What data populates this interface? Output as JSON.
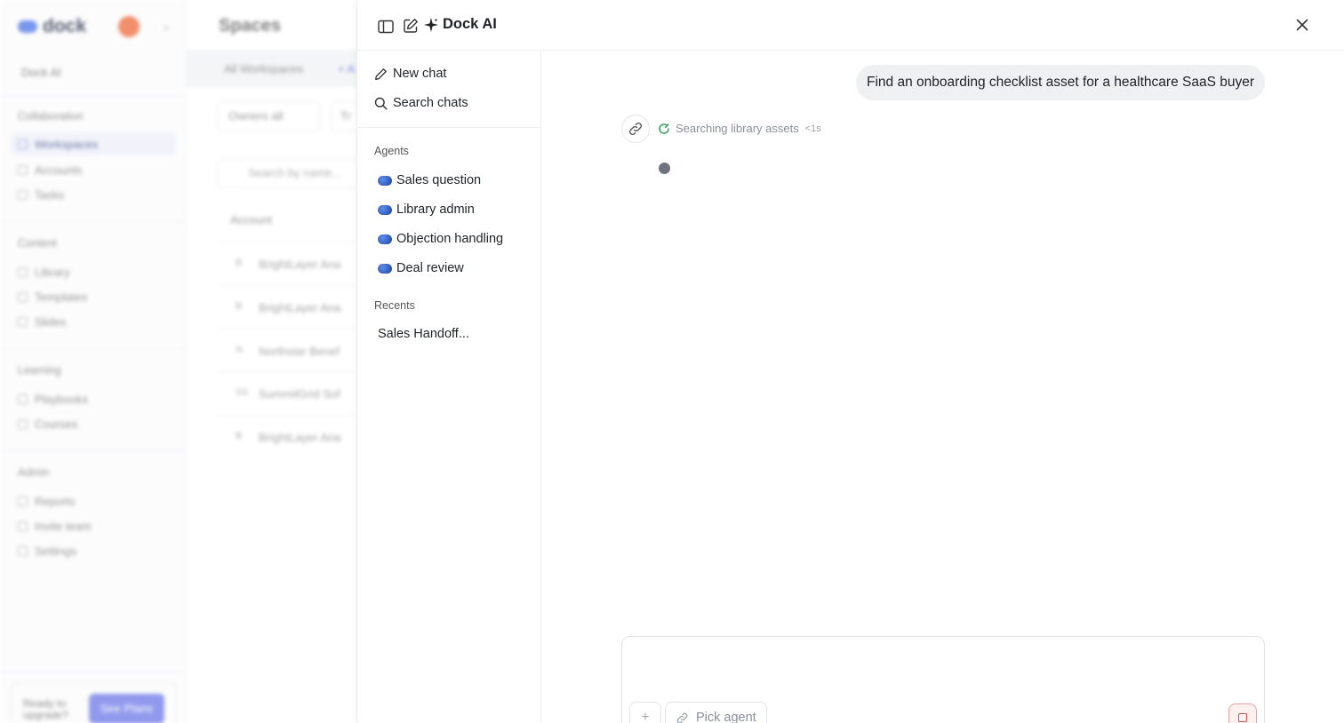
{
  "background": {
    "logo": "dock",
    "dock_ai": "Dock AI",
    "sections": {
      "collaboration": "Collaboration",
      "content": "Content",
      "learning": "Learning",
      "admin": "Admin"
    },
    "nav": {
      "workspaces": "Workspaces",
      "accounts": "Accounts",
      "tasks": "Tasks",
      "library": "Library",
      "templates": "Templates",
      "slides": "Slides",
      "playbooks": "Playbooks",
      "courses": "Courses",
      "reports": "Reports",
      "invite_team": "Invite team",
      "settings": "Settings"
    },
    "upgrade": {
      "text": "Ready to upgrade?",
      "button": "See Plans"
    },
    "main": {
      "title": "Spaces",
      "tab_all": "All Workspaces",
      "tab_add": "+ A",
      "filter_owners": "Owners all",
      "filter_tr": "Tr",
      "search_placeholder": "Search by name...",
      "col_account": "Account",
      "rows": [
        {
          "initial": "B",
          "name": "BrightLayer Ana"
        },
        {
          "initial": "B",
          "name": "BrightLayer Ana"
        },
        {
          "initial": "N",
          "name": "Northstar Benef"
        },
        {
          "initial": "SS",
          "name": "SummitGrid Sof"
        },
        {
          "initial": "B",
          "name": "BrightLayer Ana"
        }
      ]
    }
  },
  "panel": {
    "title": "Dock AI",
    "new_chat": "New chat",
    "search_chats": "Search chats",
    "agents_heading": "Agents",
    "agents": [
      {
        "label": "Sales question"
      },
      {
        "label": "Library admin"
      },
      {
        "label": "Objection handling"
      },
      {
        "label": "Deal review"
      }
    ],
    "recents_heading": "Recents",
    "recents": [
      {
        "label": "Sales Handoff..."
      }
    ]
  },
  "chat": {
    "user_message": "Find an onboarding checklist asset for a healthcare SaaS buyer",
    "status_text": "Searching library assets",
    "status_time": "<1s",
    "composer": {
      "plus": "+",
      "pick_agent": "Pick agent"
    }
  },
  "colors": {
    "accent": "#5a6ae0",
    "status_green": "#3a9a5c",
    "stop_red": "#d05050"
  }
}
